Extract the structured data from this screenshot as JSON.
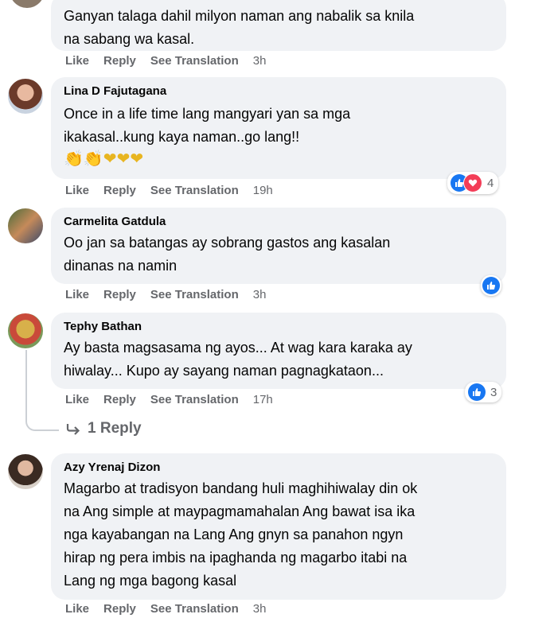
{
  "comments": [
    {
      "author": "",
      "text": "Ganyan talaga dahil milyon naman ang nabalik sa knila\nna sabang wa kasal.",
      "actions": {
        "like": "Like",
        "reply": "Reply",
        "translate": "See Translation",
        "time": "3h"
      }
    },
    {
      "author": "Lina D Fajutagana",
      "text": "Once in a life time lang mangyari yan sa mga\nikakasal..kung kaya naman..go lang!!",
      "emojis": "👏👏❤❤❤",
      "actions": {
        "like": "Like",
        "reply": "Reply",
        "translate": "See Translation",
        "time": "19h"
      },
      "reaction_count": "4"
    },
    {
      "author": "Carmelita Gatdula",
      "text": "Oo jan sa batangas ay sobrang gastos ang kasalan\ndinanas na namin",
      "actions": {
        "like": "Like",
        "reply": "Reply",
        "translate": "See Translation",
        "time": "3h"
      }
    },
    {
      "author": "Tephy Bathan",
      "text": "Ay basta magsasama ng ayos... At wag kara karaka ay\nhiwalay... Kupo ay sayang naman pagnagkataon...",
      "actions": {
        "like": "Like",
        "reply": "Reply",
        "translate": "See Translation",
        "time": "17h"
      },
      "reaction_count": "3",
      "replies_label": "1 Reply"
    },
    {
      "author": "Azy Yrenaj Dizon",
      "text": "Magarbo at tradisyon bandang huli maghihiwalay din ok\nna Ang simple at maypagmamahalan Ang bawat isa ika\nnga kayabangan na Lang Ang gnyn sa panahon ngyn\nhirap ng pera imbis na ipaghanda ng magarbo itabi na\nLang ng mga bagong kasal",
      "actions": {
        "like": "Like",
        "reply": "Reply",
        "translate": "See Translation",
        "time": "3h"
      }
    }
  ],
  "colors": {
    "bubble": "#f0f2f5",
    "meta": "#65676b",
    "like": "#1877f2",
    "love": "#f33e58"
  },
  "icons": {
    "like": "like-icon",
    "love": "love-icon",
    "reply_arrow": "reply-arrow-icon"
  }
}
